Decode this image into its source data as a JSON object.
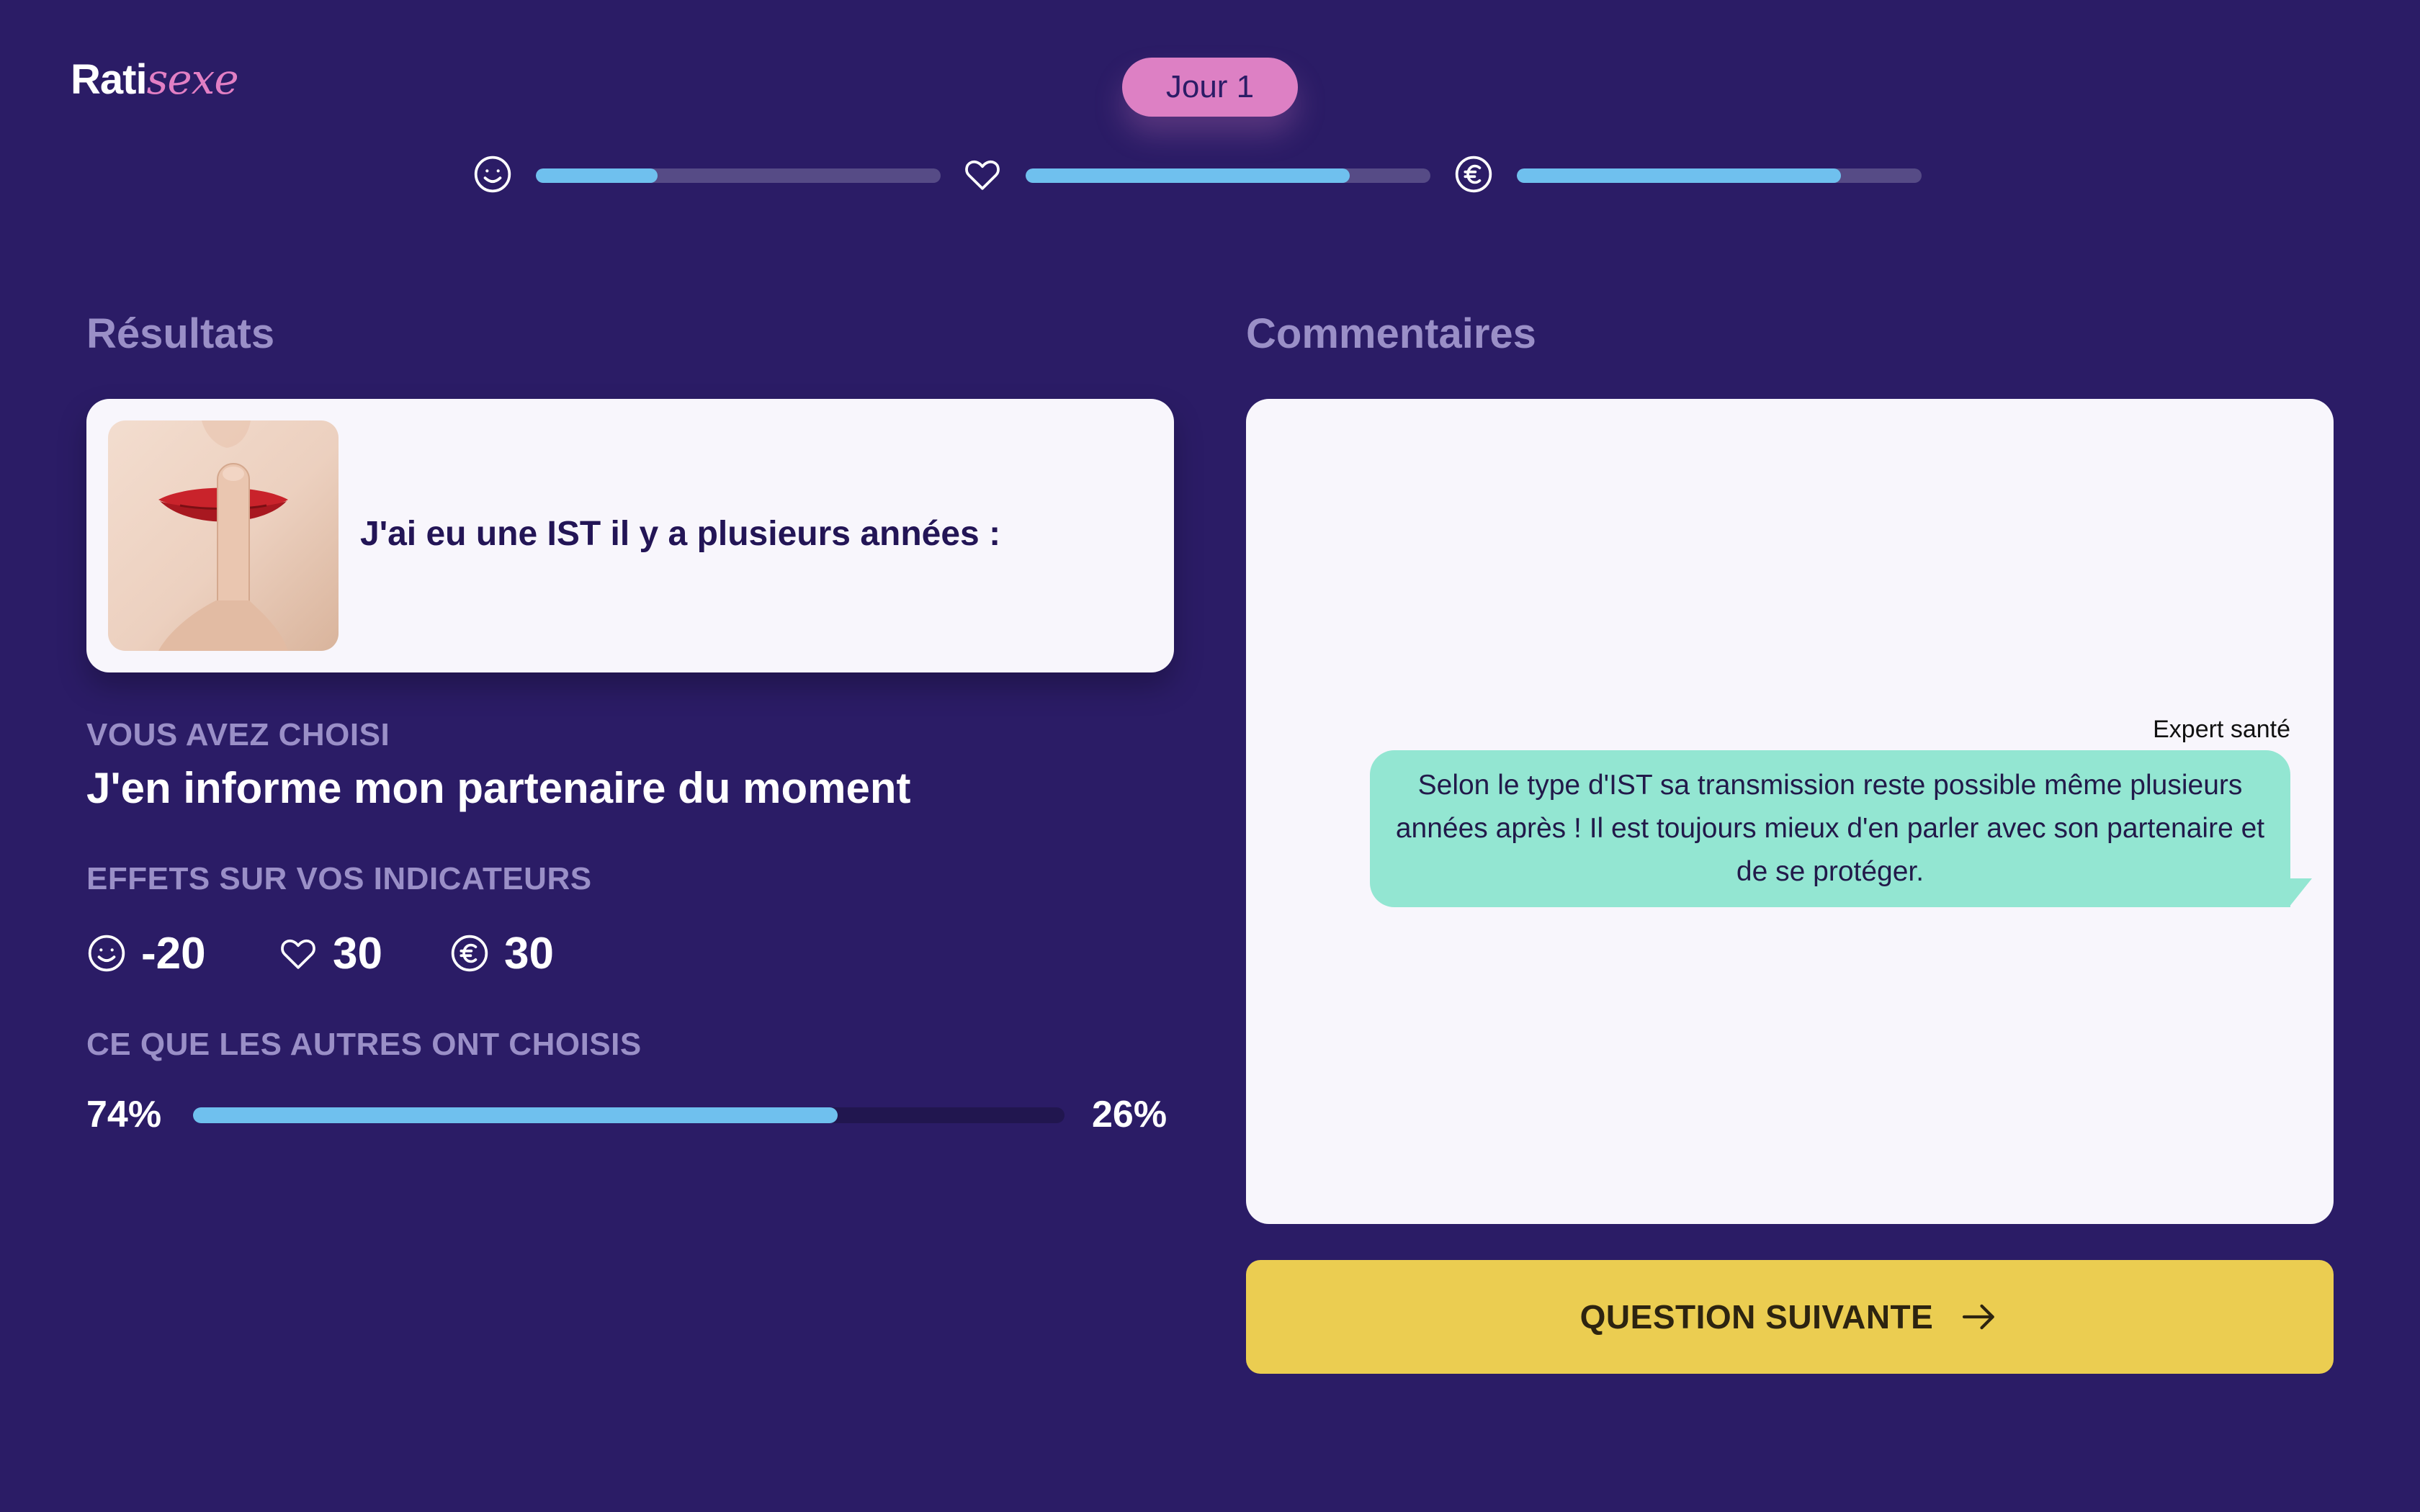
{
  "brand": {
    "part1": "Rati",
    "part2": "sexe",
    "accent_color": "#e27fc4"
  },
  "day_badge": "Jour 1",
  "indicators": [
    {
      "icon": "smiley-icon",
      "name": "humeur",
      "progress": 0.3
    },
    {
      "icon": "heart-icon",
      "name": "relation",
      "progress": 0.8
    },
    {
      "icon": "euro-icon",
      "name": "argent",
      "progress": 0.8
    }
  ],
  "results": {
    "title": "Résultats",
    "question": "J'ai eu une IST il y a plusieurs années :",
    "question_image": "woman-finger-on-lips",
    "choice_label": "VOUS AVEZ CHOISI",
    "choice": "J'en informe mon partenaire du moment",
    "effects_label": "EFFETS SUR VOS INDICATEURS",
    "effects": [
      {
        "icon": "smiley-icon",
        "value": "-20"
      },
      {
        "icon": "heart-icon",
        "value": "30"
      },
      {
        "icon": "euro-icon",
        "value": "30"
      }
    ],
    "others_label": "CE QUE LES AUTRES ONT CHOISIS",
    "others": {
      "left_pct": "74%",
      "right_pct": "26%",
      "left_fraction": 0.74
    }
  },
  "comments": {
    "title": "Commentaires",
    "speaker": "Expert santé",
    "message": "Selon le type d'IST sa transmission reste possible même plusieurs années après ! Il est toujours mieux d'en parler avec son partenaire et de se protéger."
  },
  "next_button": {
    "label": "QUESTION SUIVANTE",
    "icon": "arrow-right-icon"
  },
  "colors": {
    "background": "#2b1c66",
    "progress": "#6fc0ee",
    "button": "#ebcd51",
    "bubble": "#93e6d2",
    "muted_text": "#9a8fc7"
  }
}
